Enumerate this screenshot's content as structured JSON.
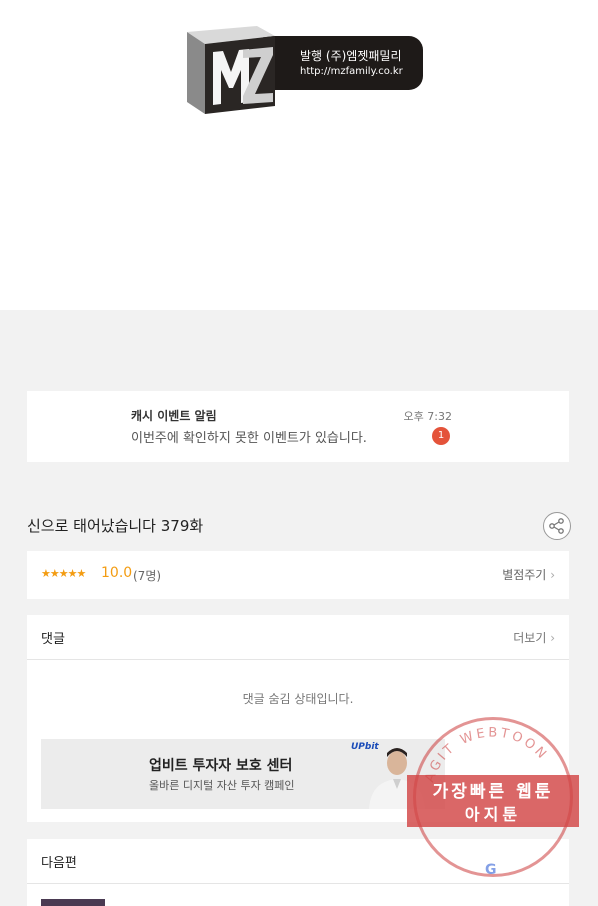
{
  "publisher_logo": {
    "line1": "발행 (주)엠젯패밀리",
    "line2": "http://mzfamily.co.kr",
    "logo_text": "MZ"
  },
  "notification": {
    "title": "캐시 이벤트 알림",
    "message": "이번주에 확인하지 못한 이벤트가 있습니다.",
    "time": "오후 7:32",
    "badge": "1",
    "badge_color": "#e4533a"
  },
  "episode": {
    "title": "신으로 태어났습니다 379화",
    "share_icon": "share-icon"
  },
  "rating": {
    "stars": "★★★★★",
    "score": "10.0",
    "count": "(7명)",
    "rate_label": "별점주기",
    "accent_color": "#f39c12"
  },
  "comments": {
    "label": "댓글",
    "more_label": "더보기",
    "hidden_message": "댓글 숨김 상태입니다."
  },
  "ad": {
    "title": "업비트 투자자 보호 센터",
    "subtitle": "올바른 디지털 자산 투자 캠페인",
    "brand": "UPbit"
  },
  "next_episode": {
    "label": "다음편"
  },
  "watermark": {
    "arc_text": "AGIT WEBTOON",
    "line1": "가장빠른 웹툰",
    "line2": "아지툰",
    "google": "G"
  }
}
